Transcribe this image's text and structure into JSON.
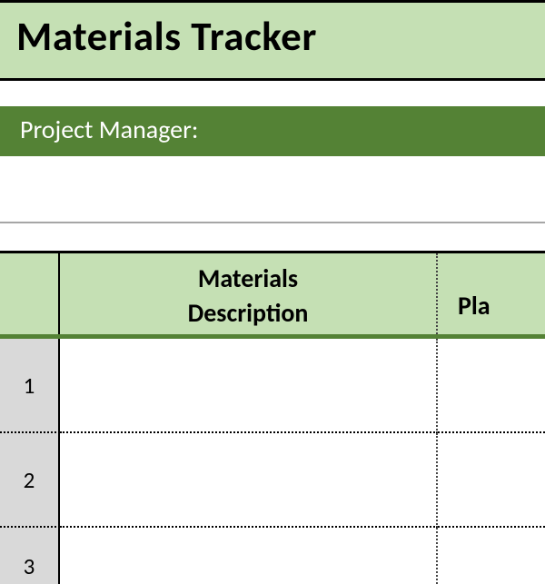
{
  "title": "Materials Tracker",
  "project_manager": {
    "label": "Project Manager:",
    "value": ""
  },
  "table": {
    "headers": {
      "row_number": "",
      "description": "Materials\nDescription",
      "column2_partial": "Pla"
    },
    "rows": [
      {
        "num": "1",
        "description": "",
        "col2": ""
      },
      {
        "num": "2",
        "description": "",
        "col2": ""
      },
      {
        "num": "3",
        "description": "",
        "col2": ""
      }
    ]
  },
  "colors": {
    "light_green": "#c5e0b4",
    "dark_green": "#548235",
    "gray": "#d9d9d9"
  }
}
